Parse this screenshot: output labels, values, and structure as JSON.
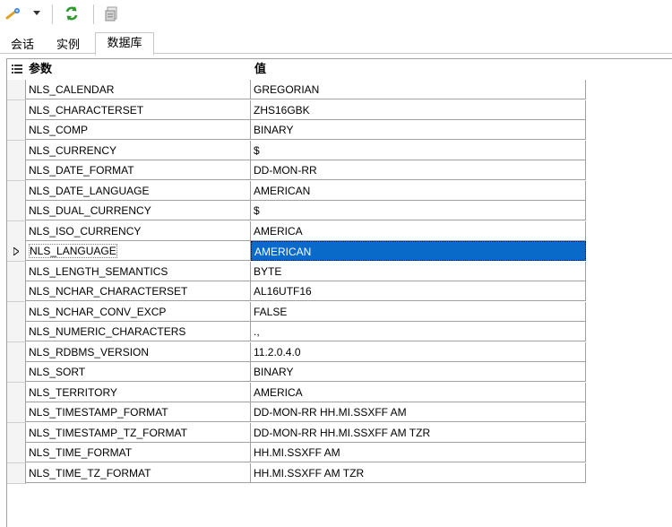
{
  "toolbar": {
    "buttons": [
      {
        "icon": "connect-wand-icon",
        "label": ""
      },
      {
        "icon": "dropdown-arrow-icon",
        "label": ""
      },
      {
        "icon": "refresh-icon",
        "label": ""
      },
      {
        "icon": "export-icon",
        "label": ""
      }
    ]
  },
  "tabs": [
    {
      "label": "会话",
      "active": false
    },
    {
      "label": "实例",
      "active": false
    },
    {
      "label": "数据库",
      "active": true
    }
  ],
  "grid": {
    "columns": [
      "参数",
      "值"
    ],
    "selected_row": 8,
    "rows": [
      {
        "param": "NLS_CALENDAR",
        "value": "GREGORIAN"
      },
      {
        "param": "NLS_CHARACTERSET",
        "value": "ZHS16GBK"
      },
      {
        "param": "NLS_COMP",
        "value": "BINARY"
      },
      {
        "param": "NLS_CURRENCY",
        "value": "$"
      },
      {
        "param": "NLS_DATE_FORMAT",
        "value": "DD-MON-RR"
      },
      {
        "param": "NLS_DATE_LANGUAGE",
        "value": "AMERICAN"
      },
      {
        "param": "NLS_DUAL_CURRENCY",
        "value": "$"
      },
      {
        "param": "NLS_ISO_CURRENCY",
        "value": "AMERICA"
      },
      {
        "param": "NLS_LANGUAGE",
        "value": "AMERICAN"
      },
      {
        "param": "NLS_LENGTH_SEMANTICS",
        "value": "BYTE"
      },
      {
        "param": "NLS_NCHAR_CHARACTERSET",
        "value": "AL16UTF16"
      },
      {
        "param": "NLS_NCHAR_CONV_EXCP",
        "value": "FALSE"
      },
      {
        "param": "NLS_NUMERIC_CHARACTERS",
        "value": ".,"
      },
      {
        "param": "NLS_RDBMS_VERSION",
        "value": "11.2.0.4.0"
      },
      {
        "param": "NLS_SORT",
        "value": "BINARY"
      },
      {
        "param": "NLS_TERRITORY",
        "value": "AMERICA"
      },
      {
        "param": "NLS_TIMESTAMP_FORMAT",
        "value": "DD-MON-RR HH.MI.SSXFF AM"
      },
      {
        "param": "NLS_TIMESTAMP_TZ_FORMAT",
        "value": "DD-MON-RR HH.MI.SSXFF AM TZR"
      },
      {
        "param": "NLS_TIME_FORMAT",
        "value": "HH.MI.SSXFF AM"
      },
      {
        "param": "NLS_TIME_TZ_FORMAT",
        "value": "HH.MI.SSXFF AM TZR"
      }
    ]
  },
  "colors": {
    "selection": "#0a6ac9",
    "grid_line": "#a0a0a0"
  }
}
